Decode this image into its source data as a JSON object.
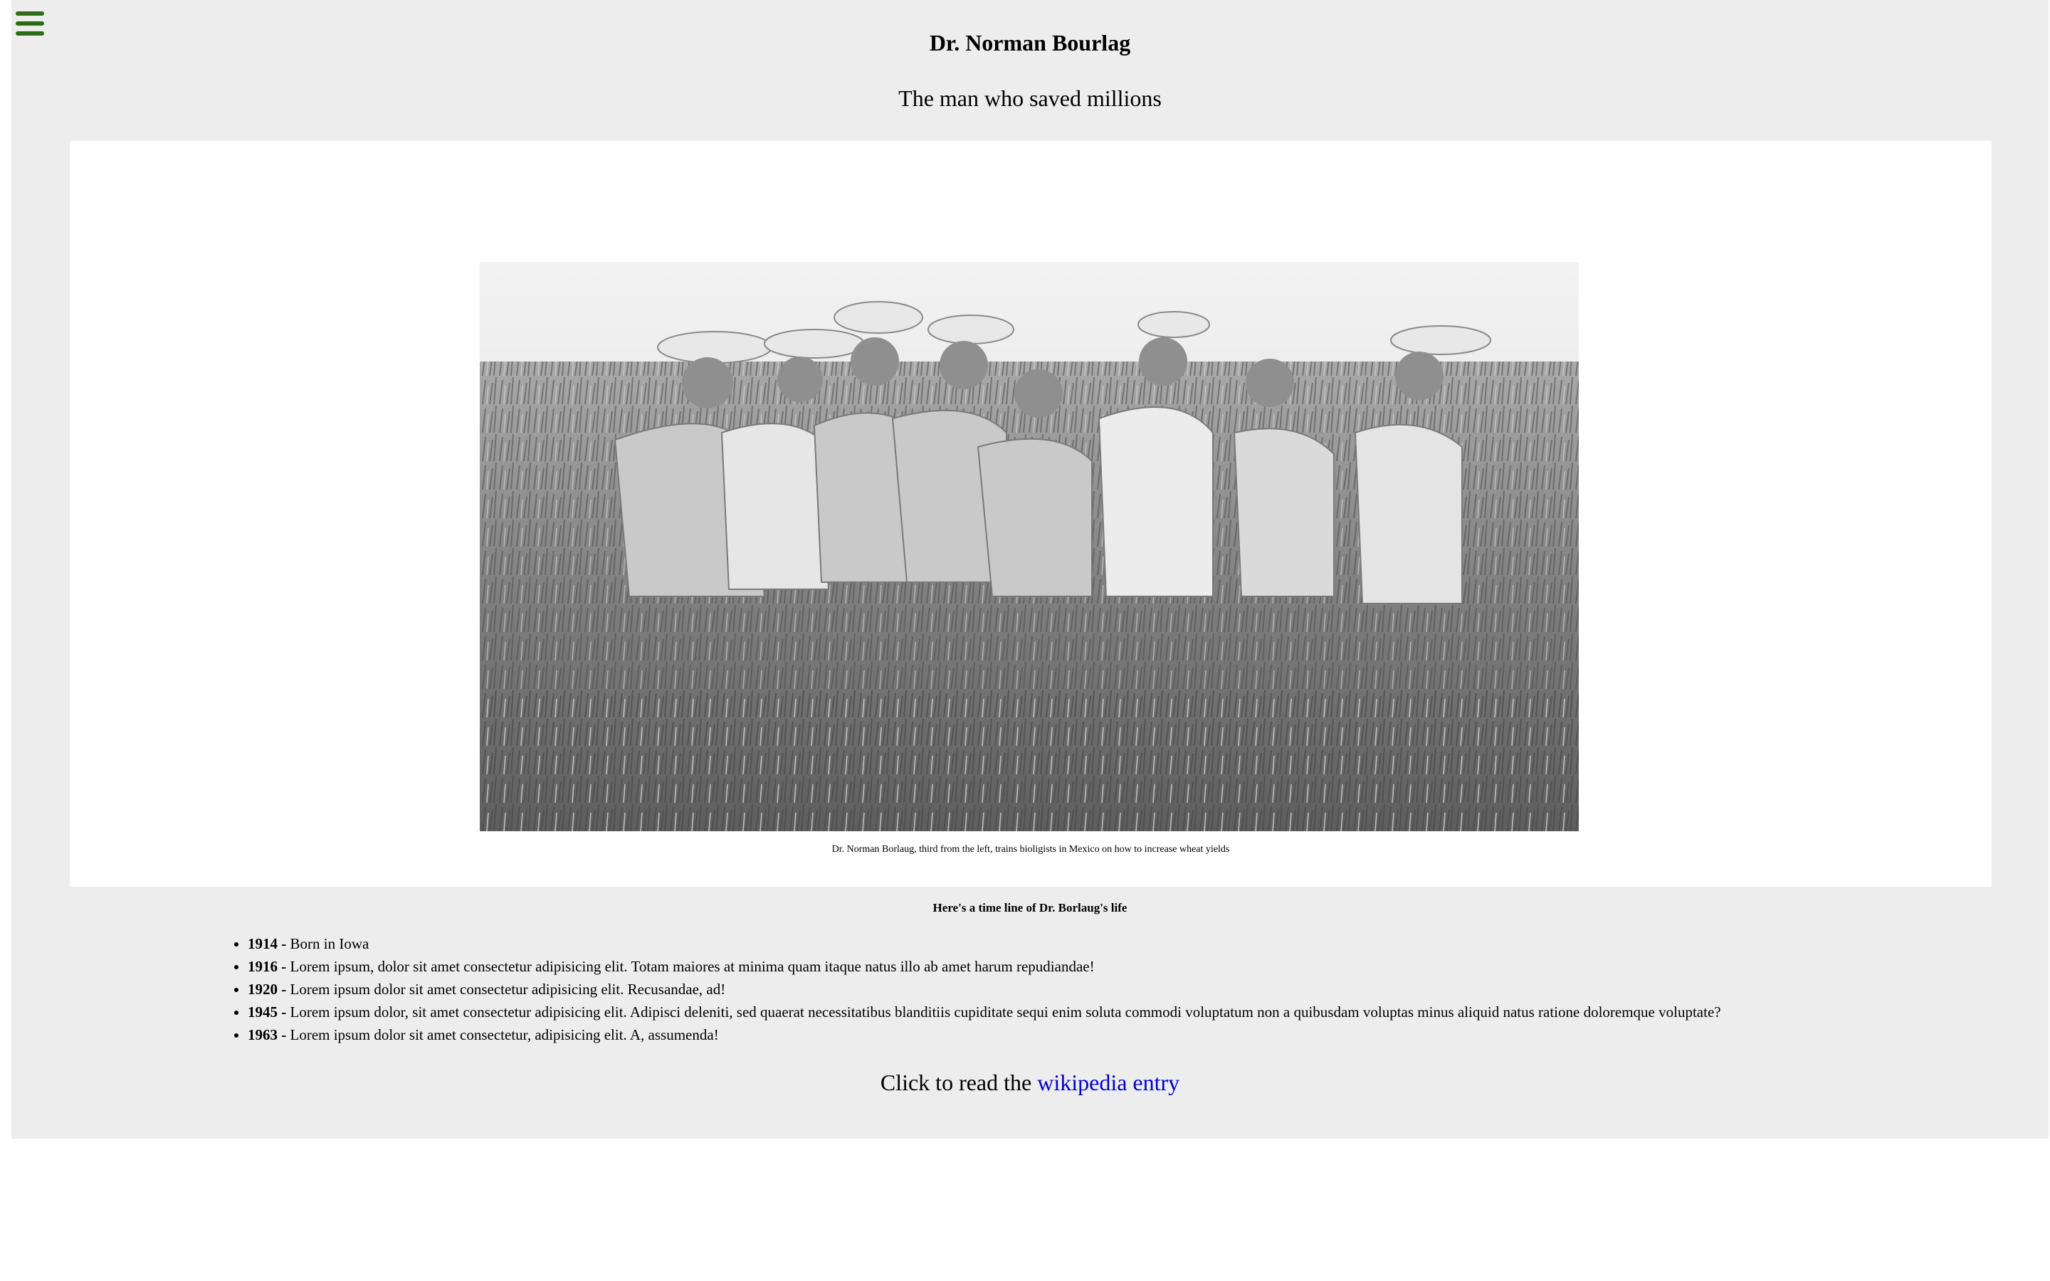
{
  "header": {
    "menu_icon": "hamburger-menu-icon",
    "title": "Dr. Norman Bourlag",
    "subtitle": "The man who saved millions"
  },
  "figure": {
    "image": "black-and-white photo of men in hats standing in a wheat field",
    "caption": "Dr. Norman Borlaug, third from the left, trains bioligists in Mexico on how to increase wheat yields"
  },
  "timeline": {
    "heading": "Here's a time line of Dr. Borlaug's life",
    "items": [
      {
        "year": "1914 -",
        "text": " Born in Iowa"
      },
      {
        "year": "1916 -",
        "text": " Lorem ipsum, dolor sit amet consectetur adipisicing elit. Totam maiores at minima quam itaque natus illo ab amet harum repudiandae!"
      },
      {
        "year": "1920 -",
        "text": " Lorem ipsum dolor sit amet consectetur adipisicing elit. Recusandae, ad!"
      },
      {
        "year": "1945 -",
        "text": " Lorem ipsum dolor, sit amet consectetur adipisicing elit. Adipisci deleniti, sed quaerat necessitatibus blanditiis cupiditate sequi enim soluta commodi voluptatum non a quibusdam voluptas minus aliquid natus ratione doloremque voluptate?"
      },
      {
        "year": "1963 -",
        "text": " Lorem ipsum dolor sit amet consectetur, adipisicing elit. A, assumenda!"
      }
    ]
  },
  "footer": {
    "prefix": "Click to read the ",
    "link_label": "wikipedia entry"
  },
  "colors": {
    "page_bg": "#ffffff",
    "panel_bg": "#ededed",
    "menu_icon": "#2e6b16",
    "link": "#0000cc"
  }
}
